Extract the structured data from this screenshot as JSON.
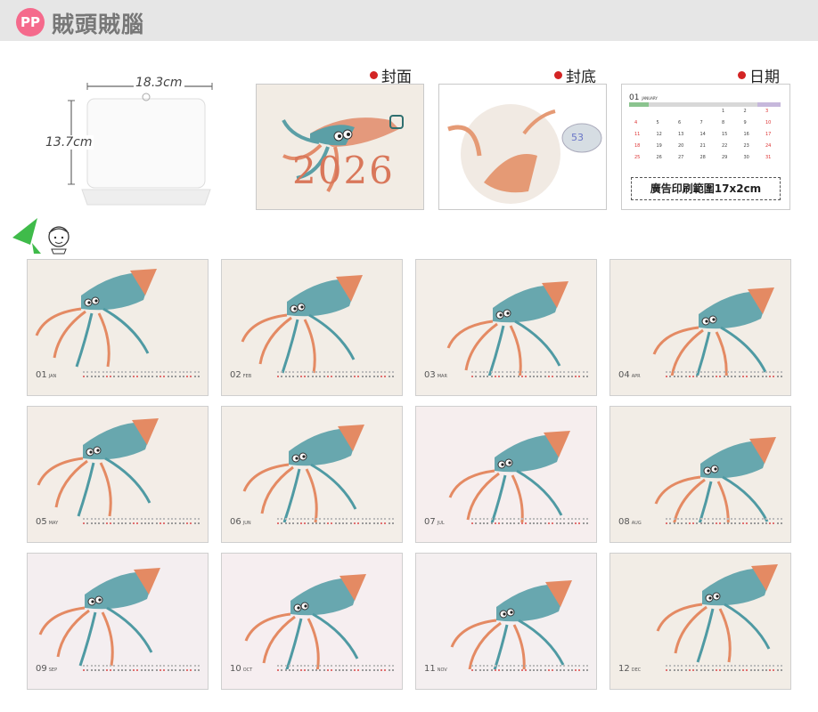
{
  "header": {
    "badge": "PP",
    "title": "賊頭賊腦"
  },
  "dimensions": {
    "width": "18.3cm",
    "height": "13.7cm"
  },
  "previews": {
    "cover_label": "封面",
    "back_label": "封底",
    "date_label": "日期",
    "ad_area": "廣告印刷範圍17x2cm",
    "cover_year": "2026",
    "back_number": "53"
  },
  "calendar_page": {
    "month": "01",
    "month_name": "JANUARY",
    "days": [
      "1",
      "2",
      "3",
      "4",
      "5",
      "6",
      "7",
      "8",
      "9",
      "10",
      "11",
      "12",
      "13",
      "14",
      "15",
      "16",
      "17",
      "18",
      "19",
      "20",
      "21",
      "22",
      "23",
      "24",
      "25",
      "26",
      "27",
      "28",
      "29",
      "30",
      "31"
    ]
  },
  "months": [
    {
      "num": "01",
      "abbr": "JAN"
    },
    {
      "num": "02",
      "abbr": "FEB"
    },
    {
      "num": "03",
      "abbr": "MAR"
    },
    {
      "num": "04",
      "abbr": "APR"
    },
    {
      "num": "05",
      "abbr": "MAY"
    },
    {
      "num": "06",
      "abbr": "JUN"
    },
    {
      "num": "07",
      "abbr": "JUL"
    },
    {
      "num": "08",
      "abbr": "AUG"
    },
    {
      "num": "09",
      "abbr": "SEP"
    },
    {
      "num": "10",
      "abbr": "OCT"
    },
    {
      "num": "11",
      "abbr": "NOV"
    },
    {
      "num": "12",
      "abbr": "DEC"
    }
  ],
  "colors": {
    "accent": "#d32424",
    "badge": "#f56a8c",
    "squid_teal": "#4f9aa3",
    "squid_orange": "#e48a63",
    "paper": "#f3ede6"
  },
  "icons": {
    "green_arrow": "green-triangle-arrow-icon",
    "face": "cartoon-face-icon"
  }
}
